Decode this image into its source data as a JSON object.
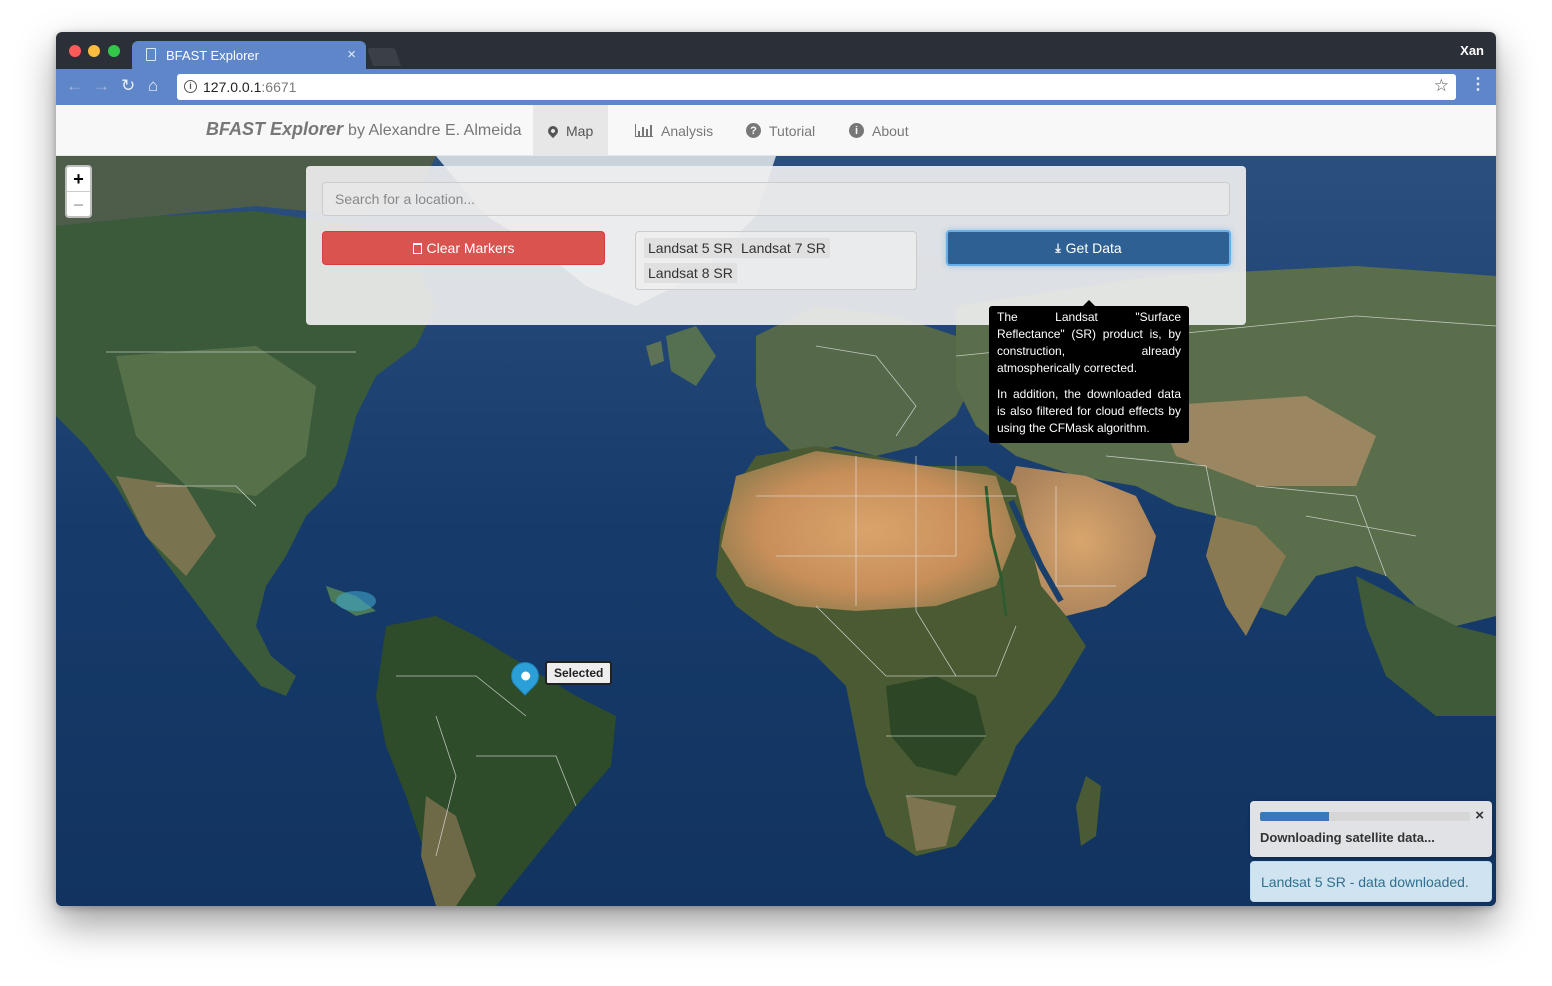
{
  "browser": {
    "tab_title": "BFAST Explorer",
    "tab_close": "×",
    "profile_name": "Xan",
    "url_host": "127.0.0.1",
    "url_port": ":6671",
    "icons": [
      "back-arrow-icon",
      "forward-arrow-icon",
      "reload-icon",
      "home-icon",
      "info-icon",
      "star-icon",
      "kebab-menu-icon"
    ]
  },
  "navbar": {
    "brand_name": "BFAST Explorer",
    "brand_by": "by Alexandre E. Almeida",
    "items": [
      {
        "label": "Map",
        "icon": "map-marker-icon",
        "active": true
      },
      {
        "label": "Analysis",
        "icon": "bar-chart-icon",
        "active": false
      },
      {
        "label": "Tutorial",
        "icon": "question-circle-icon",
        "active": false
      },
      {
        "label": "About",
        "icon": "info-circle-icon",
        "active": false
      }
    ]
  },
  "map": {
    "zoom_in": "+",
    "zoom_out": "–",
    "marker_label": "Selected",
    "marker_color": "#2b9fd8"
  },
  "panel": {
    "search_placeholder": "Search for a location...",
    "clear_label": "Clear Markers",
    "clear_color": "#d9534f",
    "get_label": "Get Data",
    "get_color": "#2e6093",
    "sensors": [
      "Landsat 5 SR",
      "Landsat 7 SR",
      "Landsat 8 SR"
    ],
    "tooltip_p1": "The Landsat \"Surface Reflectance\" (SR) product is, by construction, already atmospherically corrected.",
    "tooltip_p2": "In addition, the downloaded data is also filtered for cloud effects by using the CFMask algorithm."
  },
  "notifications": {
    "progress_text": "Downloading satellite data...",
    "progress_fraction": 0.33,
    "close": "×",
    "done_text": "Landsat 5 SR - data downloaded."
  }
}
